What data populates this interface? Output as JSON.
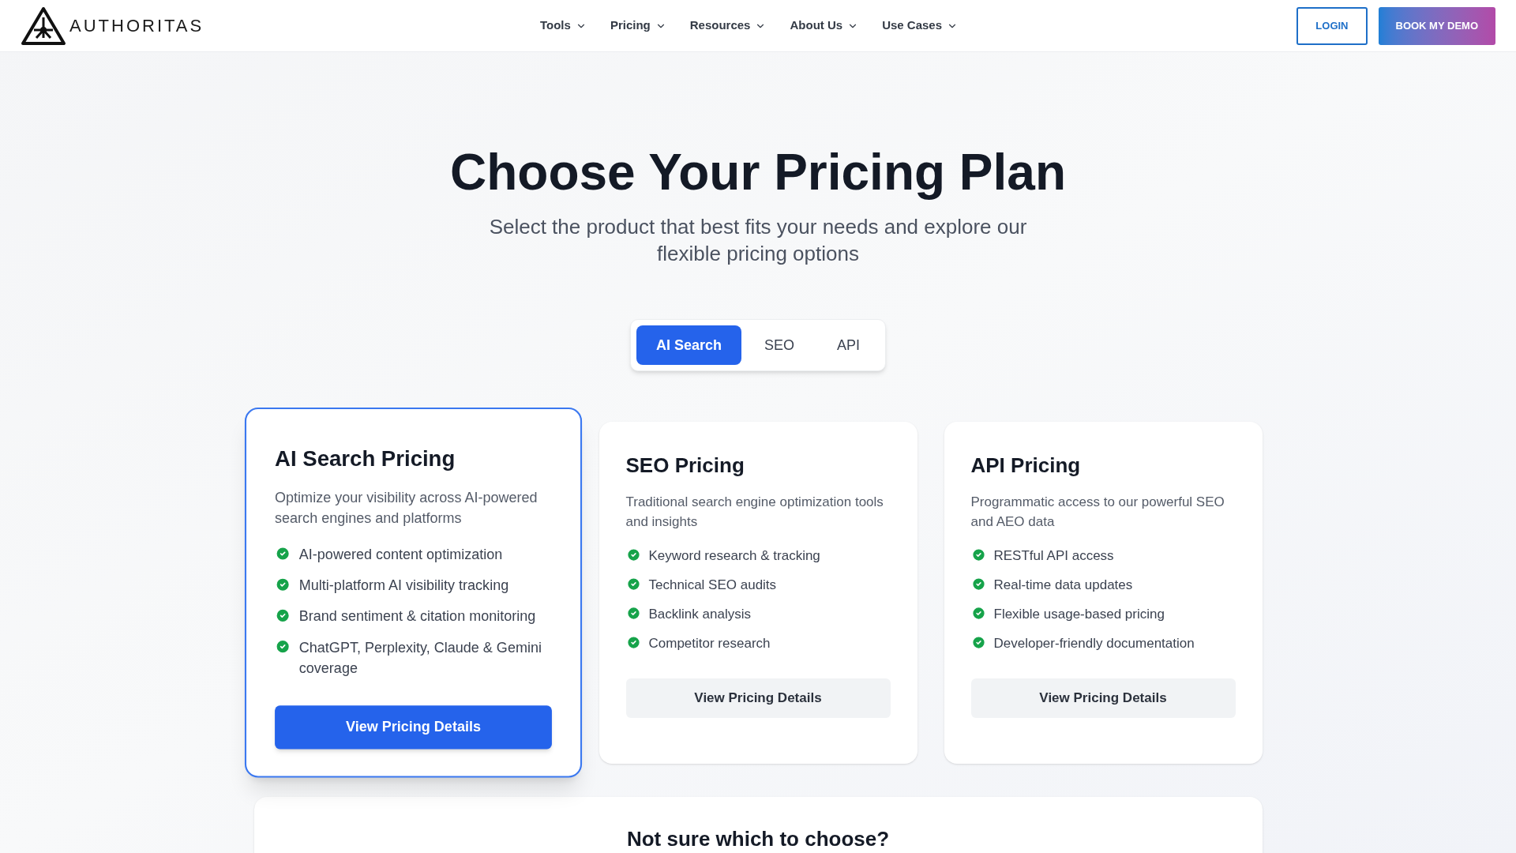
{
  "header": {
    "logo_text": "AUTHORITAS",
    "nav": [
      {
        "label": "Tools"
      },
      {
        "label": "Pricing"
      },
      {
        "label": "Resources"
      },
      {
        "label": "About Us"
      },
      {
        "label": "Use Cases"
      }
    ],
    "login": "LOGIN",
    "demo": "BOOK MY DEMO"
  },
  "hero": {
    "title": "Choose Your Pricing Plan",
    "subtitle": "Select the product that best fits your needs and explore our flexible pricing options"
  },
  "tabs": [
    {
      "label": "AI Search",
      "selected": true
    },
    {
      "label": "SEO",
      "selected": false
    },
    {
      "label": "API",
      "selected": false
    }
  ],
  "cards": [
    {
      "title": "AI Search Pricing",
      "description": "Optimize your visibility across AI-powered search engines and platforms",
      "selected": true,
      "features": [
        "AI-powered content optimization",
        "Multi-platform AI visibility tracking",
        "Brand sentiment & citation monitoring",
        "ChatGPT, Perplexity, Claude & Gemini coverage"
      ],
      "button": "View Pricing Details"
    },
    {
      "title": "SEO Pricing",
      "description": "Traditional search engine optimization tools and insights",
      "selected": false,
      "features": [
        "Keyword research & tracking",
        "Technical SEO audits",
        "Backlink analysis",
        "Competitor research"
      ],
      "button": "View Pricing Details"
    },
    {
      "title": "API Pricing",
      "description": "Programmatic access to our powerful SEO and AEO data",
      "selected": false,
      "features": [
        "RESTful API access",
        "Real-time data updates",
        "Flexible usage-based pricing",
        "Developer-friendly documentation"
      ],
      "button": "View Pricing Details"
    }
  ],
  "help": {
    "title": "Not sure which to choose?"
  }
}
